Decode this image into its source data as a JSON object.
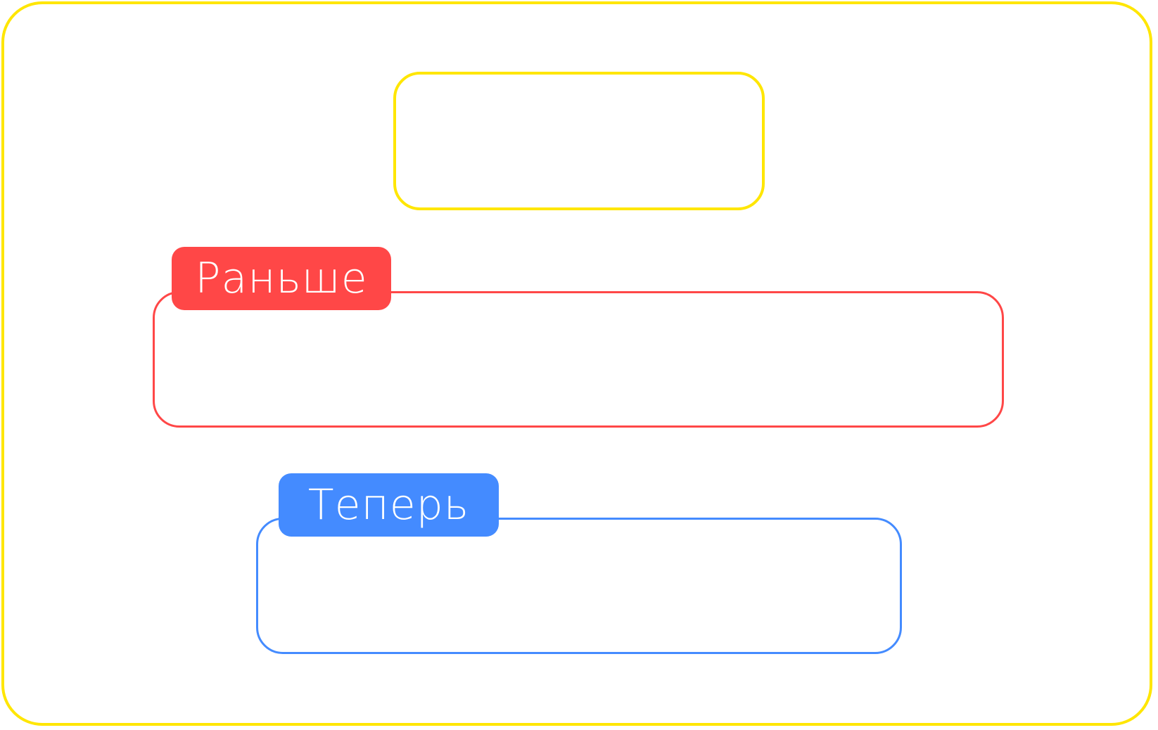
{
  "colors": {
    "frame": "#ffe600",
    "before": "#ff4747",
    "now": "#448bff",
    "label_text": "#ffffff",
    "background": "#ffffff"
  },
  "tags": {
    "before": "Раньше",
    "now": "Теперь"
  }
}
